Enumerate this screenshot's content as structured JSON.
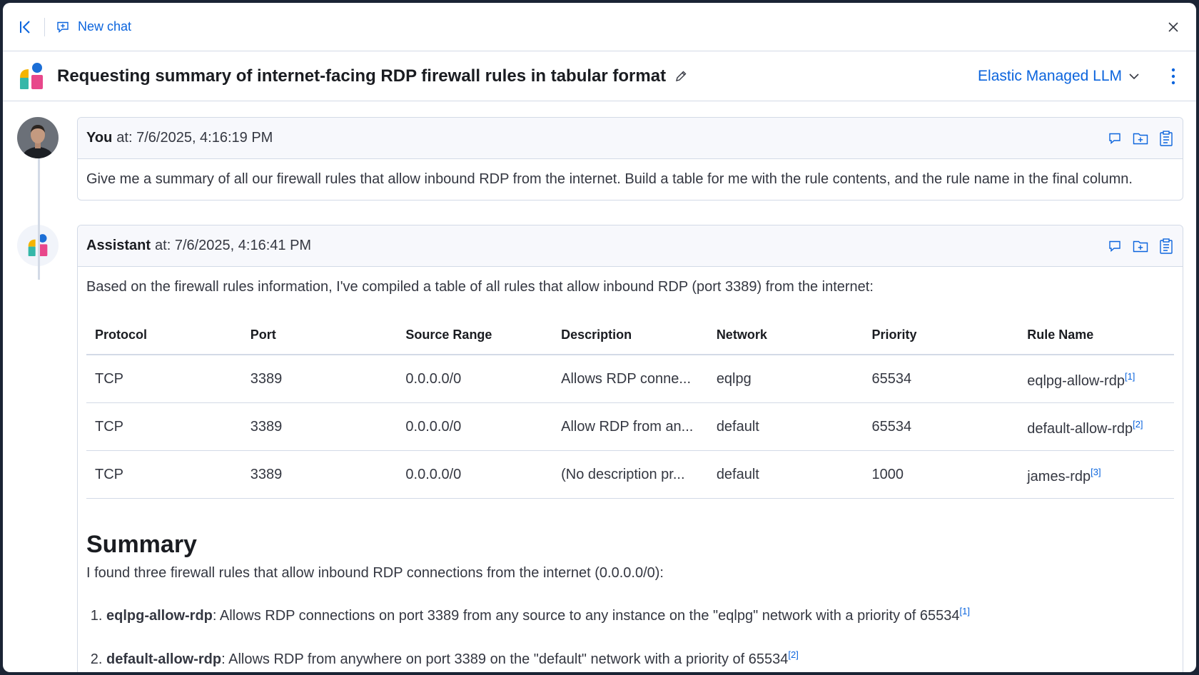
{
  "topbar": {
    "new_chat_label": "New chat"
  },
  "titlebar": {
    "title": "Requesting summary of internet-facing RDP firewall rules in tabular format",
    "llm_label": "Elastic Managed LLM"
  },
  "messages": {
    "user": {
      "author": "You",
      "at": "at: 7/6/2025, 4:16:19 PM",
      "text": "Give me a summary of all our firewall rules that allow inbound RDP from the internet. Build a table for me with the rule contents, and the rule name in the final column."
    },
    "assistant": {
      "author": "Assistant",
      "at": "at: 7/6/2025, 4:16:41 PM",
      "intro": "Based on the firewall rules information, I've compiled a table of all rules that allow inbound RDP (port 3389) from the internet:",
      "table": {
        "headers": [
          "Protocol",
          "Port",
          "Source Range",
          "Description",
          "Network",
          "Priority",
          "Rule Name"
        ],
        "rows": [
          {
            "protocol": "TCP",
            "port": "3389",
            "source": "0.0.0.0/0",
            "description": "Allows RDP conne...",
            "network": "eqlpg",
            "priority": "65534",
            "rule": "eqlpg-allow-rdp",
            "ref": "[1]"
          },
          {
            "protocol": "TCP",
            "port": "3389",
            "source": "0.0.0.0/0",
            "description": "Allow RDP from an...",
            "network": "default",
            "priority": "65534",
            "rule": "default-allow-rdp",
            "ref": "[2]"
          },
          {
            "protocol": "TCP",
            "port": "3389",
            "source": "0.0.0.0/0",
            "description": "(No description pr...",
            "network": "default",
            "priority": "1000",
            "rule": "james-rdp",
            "ref": "[3]"
          }
        ]
      },
      "summary_heading": "Summary",
      "summary_intro": "I found three firewall rules that allow inbound RDP connections from the internet (0.0.0.0/0):",
      "summary_items": [
        {
          "name": "eqlpg-allow-rdp",
          "text": ": Allows RDP connections on port 3389 from any source to any instance on the \"eqlpg\" network with a priority of 65534",
          "ref": "[1]"
        },
        {
          "name": "default-allow-rdp",
          "text": ": Allows RDP from anywhere on port 3389 on the \"default\" network with a priority of 65534",
          "ref": "[2]"
        }
      ]
    }
  },
  "colors": {
    "accent": "#0b64dd",
    "border": "#d3dae6",
    "header_bg": "#f7f8fc"
  }
}
